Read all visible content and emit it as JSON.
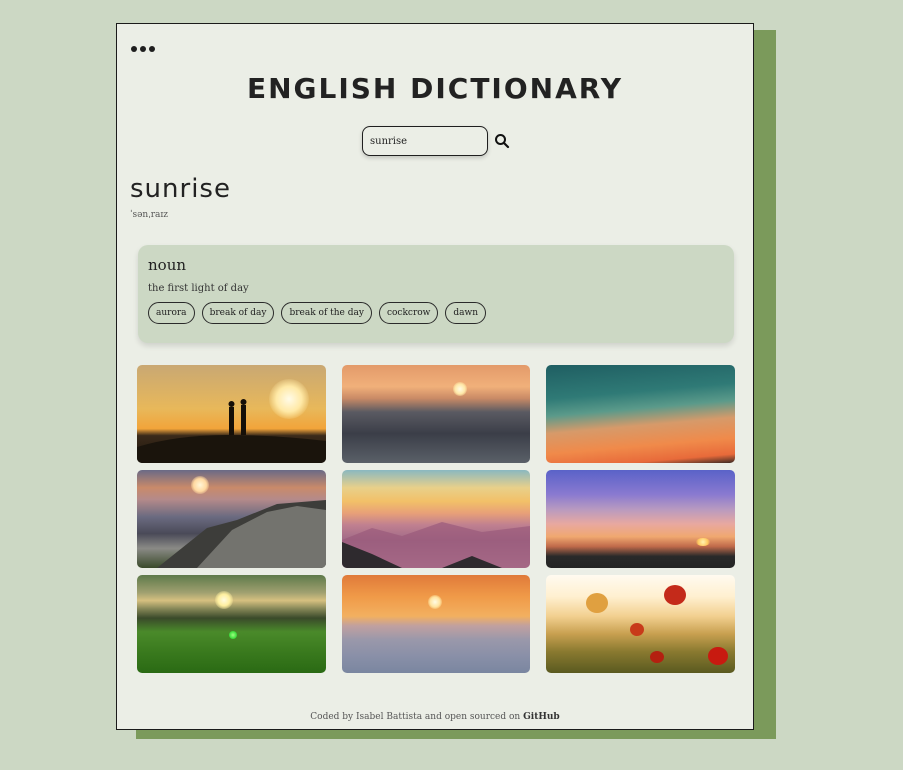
{
  "app": {
    "title": "ENGLISH DICTIONARY"
  },
  "menu": {
    "icon": "more-horizontal-icon"
  },
  "search": {
    "value": "sunrise",
    "icon": "search-icon"
  },
  "entry": {
    "word": "sunrise",
    "phonetic": "ˈsənˌraɪz",
    "meanings": [
      {
        "part_of_speech": "noun",
        "definition": "the first light of day",
        "synonyms": [
          "aurora",
          "break of day",
          "break of the day",
          "cockcrow",
          "dawn"
        ]
      }
    ]
  },
  "gallery": {
    "images": [
      {
        "name": "couple-silhouette-sunrise"
      },
      {
        "name": "ocean-waves-sunrise"
      },
      {
        "name": "teal-sky-sunset"
      },
      {
        "name": "mountain-sunrise"
      },
      {
        "name": "misty-mountains-sunrise"
      },
      {
        "name": "purple-sky-sunrise"
      },
      {
        "name": "green-field-sunrise"
      },
      {
        "name": "sea-horizon-sunrise"
      },
      {
        "name": "poppy-field-sunrise"
      }
    ]
  },
  "footer": {
    "text": "Coded by Isabel Battista and open sourced on",
    "link": "GitHub"
  }
}
